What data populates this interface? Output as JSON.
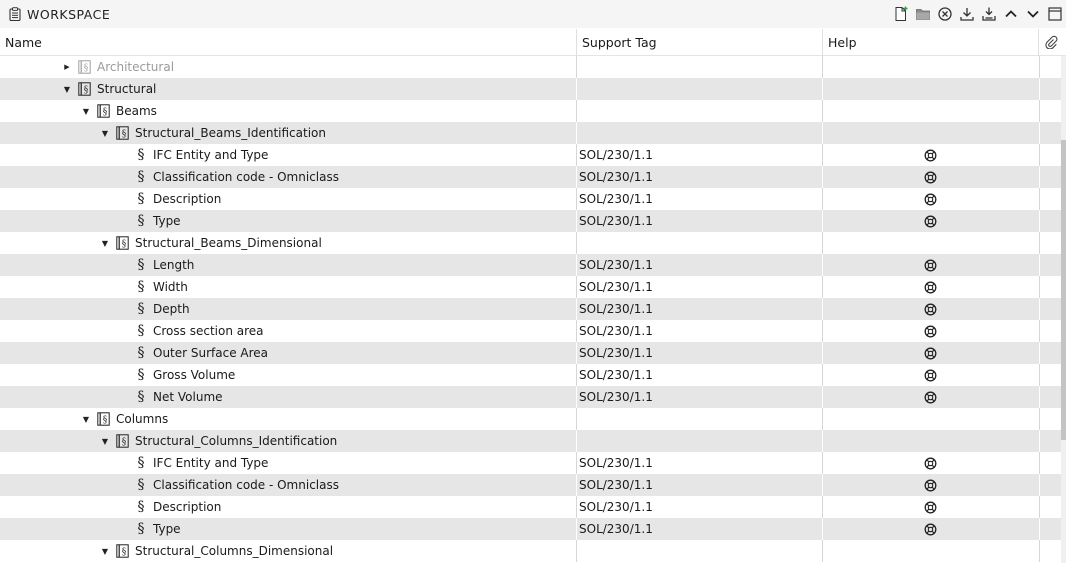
{
  "panel": {
    "title": "WORKSPACE",
    "icon": "clipboard-icon"
  },
  "toolbar": [
    {
      "name": "new-file-icon"
    },
    {
      "name": "open-folder-icon"
    },
    {
      "name": "close-circle-icon"
    },
    {
      "name": "download-icon"
    },
    {
      "name": "download-all-icon"
    },
    {
      "name": "chevron-up-icon"
    },
    {
      "name": "chevron-down-icon"
    },
    {
      "name": "panel-icon"
    }
  ],
  "columns": {
    "name": "Name",
    "support_tag": "Support Tag",
    "help": "Help",
    "link_icon": "paperclip-icon"
  },
  "colors": {
    "row_alt": "#e6e6e6",
    "row": "#ffffff",
    "dim_text": "#9a9a9a",
    "accent_new": "#2e9e3e"
  },
  "rows": [
    {
      "level": 0,
      "type": "group",
      "expanded": false,
      "dim": true,
      "label": "Architectural",
      "tag": "",
      "help": false
    },
    {
      "level": 0,
      "type": "group",
      "expanded": true,
      "label": "Structural",
      "tag": "",
      "help": false
    },
    {
      "level": 1,
      "type": "group",
      "expanded": true,
      "label": "Beams",
      "tag": "",
      "help": false
    },
    {
      "level": 2,
      "type": "group",
      "expanded": true,
      "label": "Structural_Beams_Identification",
      "tag": "",
      "help": false
    },
    {
      "level": 3,
      "type": "item",
      "label": "IFC Entity and Type",
      "tag": "SOL/230/1.1",
      "help": true
    },
    {
      "level": 3,
      "type": "item",
      "label": "Classification code - Omniclass",
      "tag": "SOL/230/1.1",
      "help": true
    },
    {
      "level": 3,
      "type": "item",
      "label": "Description",
      "tag": "SOL/230/1.1",
      "help": true
    },
    {
      "level": 3,
      "type": "item",
      "label": "Type",
      "tag": "SOL/230/1.1",
      "help": true
    },
    {
      "level": 2,
      "type": "group",
      "expanded": true,
      "label": "Structural_Beams_Dimensional",
      "tag": "",
      "help": false
    },
    {
      "level": 3,
      "type": "item",
      "label": "Length",
      "tag": "SOL/230/1.1",
      "help": true
    },
    {
      "level": 3,
      "type": "item",
      "label": "Width",
      "tag": "SOL/230/1.1",
      "help": true
    },
    {
      "level": 3,
      "type": "item",
      "label": "Depth",
      "tag": "SOL/230/1.1",
      "help": true
    },
    {
      "level": 3,
      "type": "item",
      "label": "Cross section area",
      "tag": "SOL/230/1.1",
      "help": true
    },
    {
      "level": 3,
      "type": "item",
      "label": "Outer Surface Area",
      "tag": "SOL/230/1.1",
      "help": true
    },
    {
      "level": 3,
      "type": "item",
      "label": "Gross Volume",
      "tag": "SOL/230/1.1",
      "help": true
    },
    {
      "level": 3,
      "type": "item",
      "label": "Net Volume",
      "tag": "SOL/230/1.1",
      "help": true
    },
    {
      "level": 1,
      "type": "group",
      "expanded": true,
      "label": "Columns",
      "tag": "",
      "help": false
    },
    {
      "level": 2,
      "type": "group",
      "expanded": true,
      "label": "Structural_Columns_Identification",
      "tag": "",
      "help": false
    },
    {
      "level": 3,
      "type": "item",
      "label": "IFC Entity and Type",
      "tag": "SOL/230/1.1",
      "help": true
    },
    {
      "level": 3,
      "type": "item",
      "label": "Classification code - Omniclass",
      "tag": "SOL/230/1.1",
      "help": true
    },
    {
      "level": 3,
      "type": "item",
      "label": "Description",
      "tag": "SOL/230/1.1",
      "help": true
    },
    {
      "level": 3,
      "type": "item",
      "label": "Type",
      "tag": "SOL/230/1.1",
      "help": true
    },
    {
      "level": 2,
      "type": "group",
      "expanded": true,
      "label": "Structural_Columns_Dimensional",
      "tag": "",
      "help": false
    }
  ]
}
